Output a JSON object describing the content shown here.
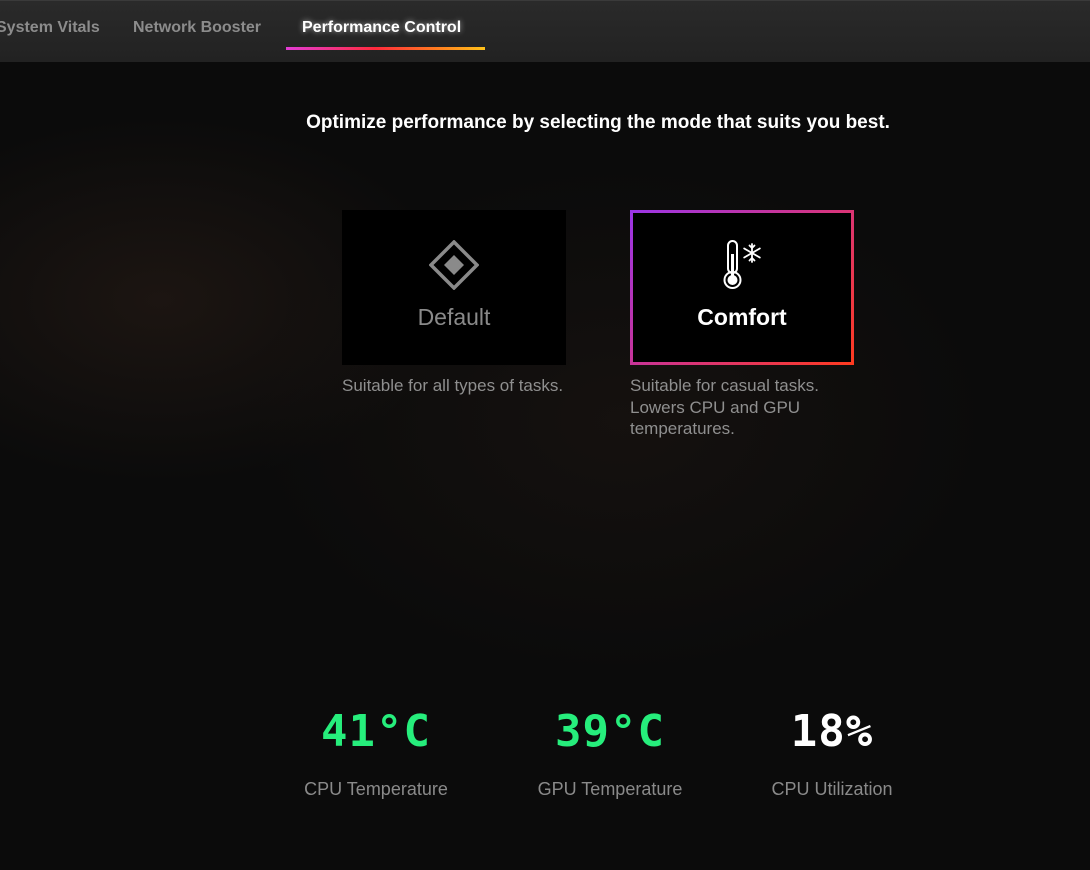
{
  "tabs": [
    {
      "label": "System Vitals",
      "active": false
    },
    {
      "label": "Network Booster",
      "active": false
    },
    {
      "label": "Performance Control",
      "active": true
    }
  ],
  "heading": "Optimize performance by selecting the mode that suits you best.",
  "modes": [
    {
      "name": "Default",
      "icon": "diamond-icon",
      "description": "Suitable for all types of tasks.",
      "selected": false
    },
    {
      "name": "Comfort",
      "icon": "thermometer-snowflake-icon",
      "description": "Suitable for casual tasks. Lowers CPU and GPU temperatures.",
      "selected": true
    }
  ],
  "stats": [
    {
      "value": "41°C",
      "label": "CPU Temperature",
      "color": "#26ee7c"
    },
    {
      "value": "39°C",
      "label": "GPU Temperature",
      "color": "#26ee7c"
    },
    {
      "value": "18%",
      "label": "CPU Utilization",
      "color": "#ffffff"
    }
  ],
  "colors": {
    "accent_gradient": [
      "#e23cd6",
      "#ff2a3c",
      "#ff7a20",
      "#ffc21a"
    ],
    "selected_border": [
      "#9a35e8",
      "#d7347c",
      "#ff3a1e"
    ],
    "background": "#0b0b0b"
  }
}
